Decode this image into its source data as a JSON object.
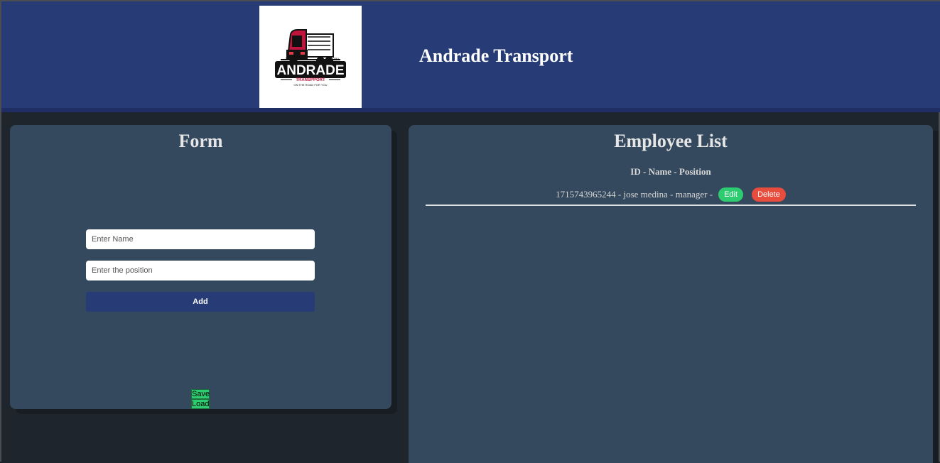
{
  "header": {
    "title": "Andrade Transport",
    "logo": {
      "icon": "truck-logo",
      "brand": "ANDRADE",
      "subtitle": "TRANSPPORT",
      "tagline": "ON THE ROAD FOR YOU"
    }
  },
  "form": {
    "title": "Form",
    "name_placeholder": "Enter Name",
    "position_placeholder": "Enter the position",
    "add_label": "Add",
    "save_label": "Save",
    "load_label": "Load"
  },
  "employee_list": {
    "title": "Employee List",
    "header": "ID - Name - Position",
    "rows": [
      {
        "text": "1715743965244 - jose medina - manager -",
        "edit_label": "Edit",
        "delete_label": "Delete"
      }
    ]
  },
  "colors": {
    "header_bg": "#273b77",
    "panel_bg": "#34495e",
    "page_bg": "#1f252c",
    "edit": "#2ecc71",
    "delete": "#e74c3c"
  }
}
